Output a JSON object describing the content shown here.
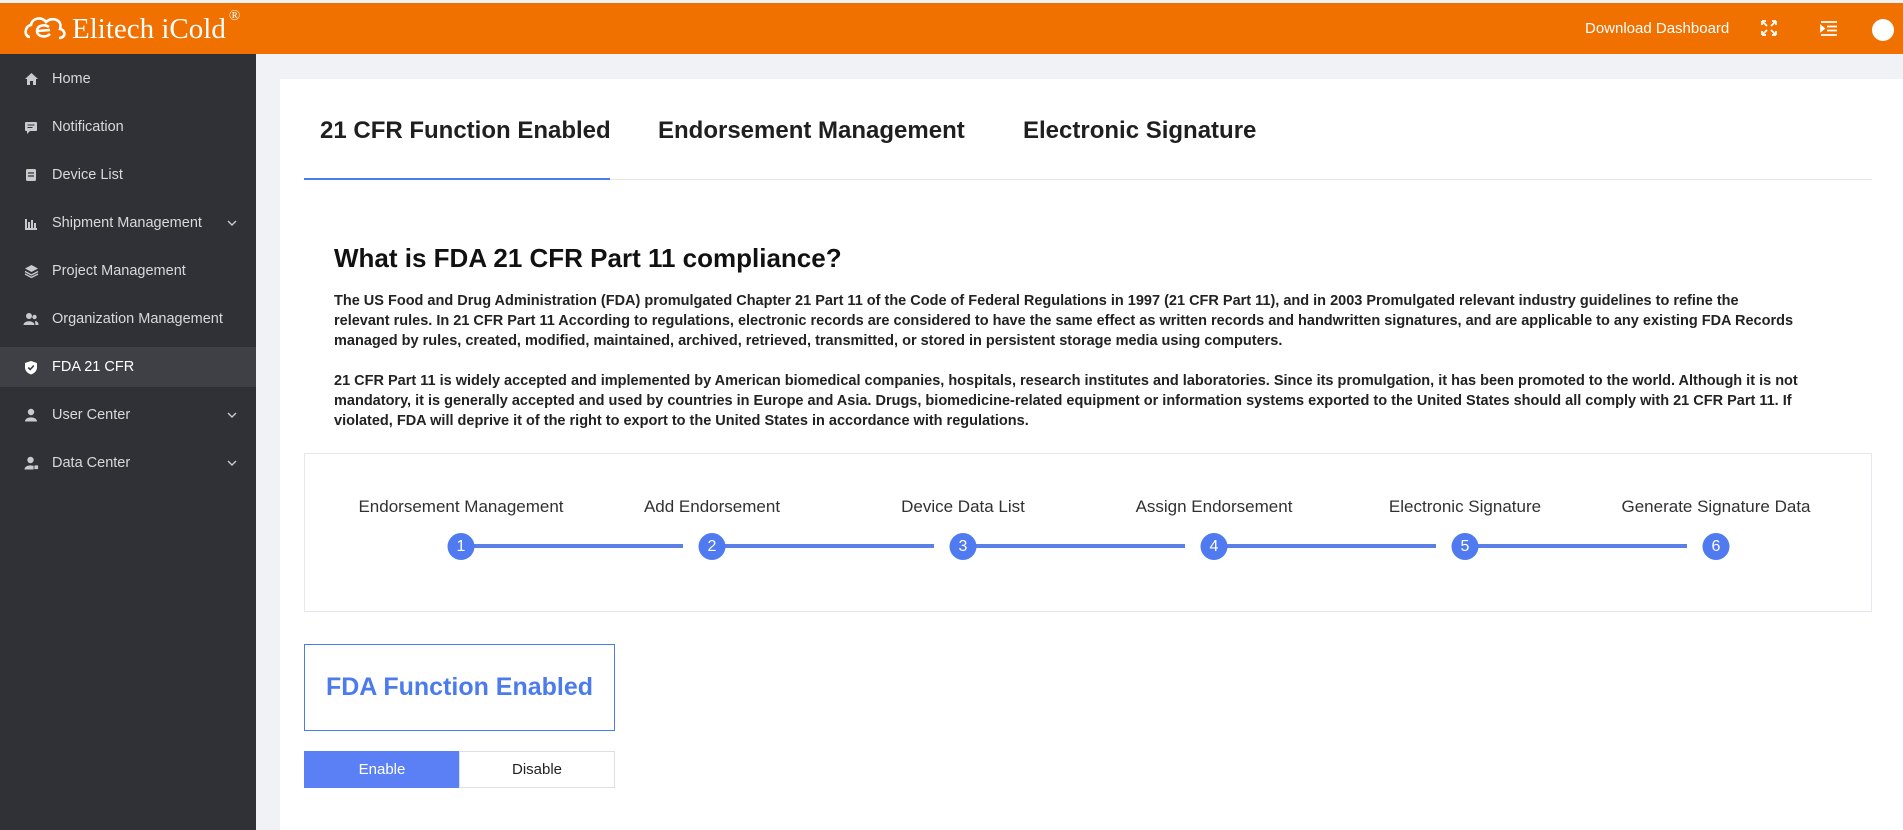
{
  "header": {
    "brand_name": "Elitech iCold",
    "brand_reg": "®",
    "download_label": "Download Dashboard",
    "icons": [
      "fullscreen-icon",
      "menu-list-icon",
      "avatar"
    ],
    "color": "#f07000"
  },
  "sidebar": {
    "items": [
      {
        "label": "Home",
        "icon": "home-icon"
      },
      {
        "label": "Notification",
        "icon": "notification-icon"
      },
      {
        "label": "Device List",
        "icon": "device-icon"
      },
      {
        "label": "Shipment Management",
        "icon": "shipment-icon",
        "expandable": true
      },
      {
        "label": "Project Management",
        "icon": "layers-icon"
      },
      {
        "label": "Organization Management",
        "icon": "group-icon"
      },
      {
        "label": "FDA 21 CFR",
        "icon": "shield-icon",
        "active": true
      },
      {
        "label": "User Center",
        "icon": "user-icon",
        "expandable": true
      },
      {
        "label": "Data Center",
        "icon": "data-user-icon",
        "expandable": true
      }
    ]
  },
  "tabs": [
    {
      "label": "21 CFR Function Enabled",
      "active": true
    },
    {
      "label": "Endorsement Management"
    },
    {
      "label": "Electronic Signature"
    }
  ],
  "content": {
    "title": "What is FDA 21 CFR Part 11 compliance?",
    "para1_lines": [
      "The US Food and Drug Administration (FDA) promulgated Chapter 21 Part 11 of the Code of Federal Regulations in 1997 (21 CFR Part 11), and in 2003 Promulgated relevant industry guidelines to refine the",
      "relevant rules. In 21 CFR Part 11 According to regulations, electronic records are considered to have the same effect as written records and handwritten signatures, and are applicable to any existing FDA Records",
      "managed by rules, created, modified, maintained, archived, retrieved, transmitted, or stored in persistent storage media using computers."
    ],
    "para2_lines": [
      "21 CFR Part 11 is widely accepted and implemented by American biomedical companies, hospitals, research institutes and laboratories. Since its promulgation, it has been promoted to the world. Although it is not",
      "mandatory, it is generally accepted and used by countries in Europe and Asia. Drugs, biomedicine-related equipment or information systems exported to the United States should all comply with 21 CFR Part 11. If",
      "violated, FDA will deprive it of the right to export to the United States in accordance with regulations."
    ]
  },
  "steps": [
    {
      "number": "1",
      "label": "Endorsement Management"
    },
    {
      "number": "2",
      "label": "Add Endorsement"
    },
    {
      "number": "3",
      "label": "Device Data List"
    },
    {
      "number": "4",
      "label": "Assign Endorsement"
    },
    {
      "number": "5",
      "label": "Electronic Signature"
    },
    {
      "number": "6",
      "label": "Generate Signature Data"
    }
  ],
  "fda_function": {
    "label": "FDA Function Enabled",
    "enable_label": "Enable",
    "disable_label": "Disable",
    "selected": "Enable"
  }
}
